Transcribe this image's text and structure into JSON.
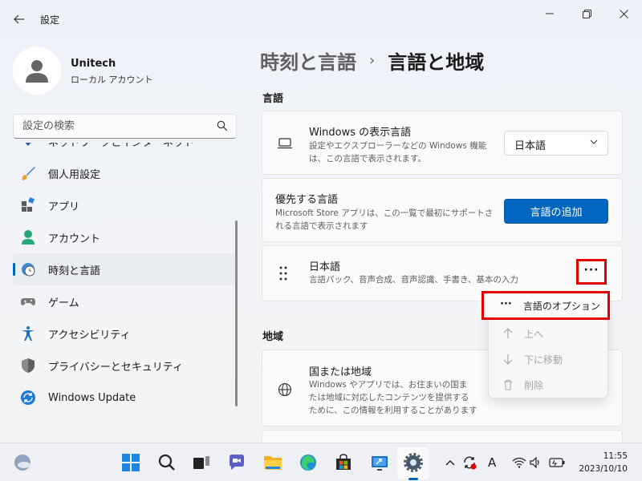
{
  "window": {
    "title": "設定"
  },
  "profile": {
    "name": "Unitech",
    "account_type": "ローカル アカウント"
  },
  "search": {
    "placeholder": "設定の検索"
  },
  "sidebar": {
    "items": [
      {
        "label": "ネットワークとインターネット",
        "icon": "network-icon"
      },
      {
        "label": "個人用設定",
        "icon": "brush-icon"
      },
      {
        "label": "アプリ",
        "icon": "apps-icon"
      },
      {
        "label": "アカウント",
        "icon": "account-icon"
      },
      {
        "label": "時刻と言語",
        "icon": "time-language-icon",
        "active": true
      },
      {
        "label": "ゲーム",
        "icon": "gaming-icon"
      },
      {
        "label": "アクセシビリティ",
        "icon": "accessibility-icon"
      },
      {
        "label": "プライバシーとセキュリティ",
        "icon": "shield-icon"
      },
      {
        "label": "Windows Update",
        "icon": "update-icon"
      }
    ]
  },
  "breadcrumb": {
    "parent": "時刻と言語",
    "separator": "›",
    "current": "言語と地域"
  },
  "language_section": {
    "title": "言語",
    "display_language": {
      "title": "Windows の表示言語",
      "desc_line1": "設定やエクスプローラーなどの Windows 機能",
      "desc_line2": "は、この言語で表示されます。",
      "value": "日本語"
    },
    "preferred": {
      "title": "優先する言語",
      "desc_line1": "Microsoft Store アプリは、この一覧で最初にサポートさ",
      "desc_line2": "れる言語で表示されます",
      "button": "言語の追加"
    },
    "japanese": {
      "title": "日本語",
      "desc": "言語パック、音声合成、音声認識、手書き、基本の入力",
      "more": "···"
    }
  },
  "context_menu": {
    "options": "言語のオプション",
    "move_up": "上へ",
    "move_down": "下に移動",
    "remove": "削除"
  },
  "region_section": {
    "title": "地域",
    "country": {
      "title": "国または地域",
      "desc_line1": "Windows やアプリでは、お住まいの国ま",
      "desc_line2": "たは地域に対応したコンテンツを提供する",
      "desc_line3": "ために、この情報を利用することがあります"
    }
  },
  "taskbar": {
    "time": "11:55",
    "date": "2023/10/10",
    "ime": "A"
  },
  "colors": {
    "accent": "#0067c0",
    "highlight": "#e00000"
  }
}
